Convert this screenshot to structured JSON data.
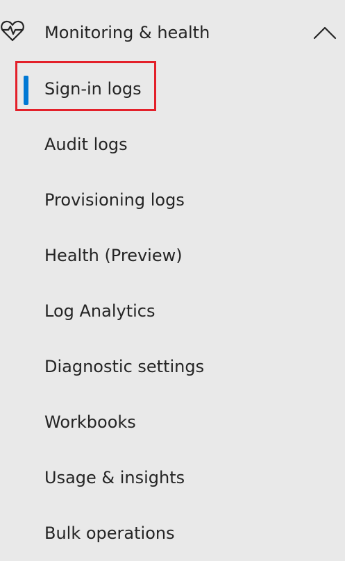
{
  "nav": {
    "group": {
      "label": "Monitoring & health",
      "icon": "heart-pulse-icon",
      "expanded": true,
      "chevron": "chevron-up-icon"
    },
    "items": [
      {
        "label": "Sign-in logs",
        "selected": true
      },
      {
        "label": "Audit logs"
      },
      {
        "label": "Provisioning logs"
      },
      {
        "label": "Health (Preview)"
      },
      {
        "label": "Log Analytics"
      },
      {
        "label": "Diagnostic settings"
      },
      {
        "label": "Workbooks"
      },
      {
        "label": "Usage & insights"
      },
      {
        "label": "Bulk operations"
      }
    ]
  },
  "colors": {
    "background": "#e9e9e9",
    "text": "#242424",
    "active_indicator": "#0078d4",
    "highlight_box": "#e3202a"
  }
}
